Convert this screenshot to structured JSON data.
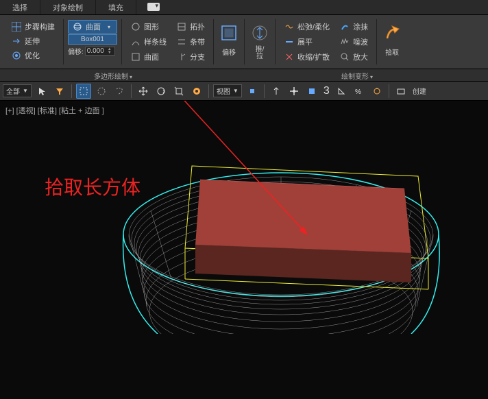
{
  "tabs": {
    "select": "选择",
    "object_paint": "对象绘制",
    "fill": "填充"
  },
  "ribbon": {
    "step_build": "步骤构建",
    "extend": "延伸",
    "optimize": "优化",
    "surface": "曲面",
    "object_name": "Box001",
    "offset_label": "偏移:",
    "offset_value": "0.000",
    "shape": "图形",
    "spline": "样条线",
    "face": "曲面",
    "topology": "拓扑",
    "strip": "条带",
    "branch": "分支",
    "offset_big": "偏移",
    "push_pull_1": "推/",
    "push_pull_2": "拉",
    "relax_soften": "松弛/柔化",
    "flatten": "展平",
    "shrink_expand": "收缩/扩散",
    "smear": "涂抹",
    "noise": "噪波",
    "zoom": "放大",
    "pick": "拾取"
  },
  "group_labels": {
    "poly_draw": "多边形绘制",
    "paint_deform": "绘制变形"
  },
  "toolbar2": {
    "all": "全部",
    "view": "视图",
    "create": "创建"
  },
  "viewport": {
    "label": "[+] [透视] [标准] [粘土 + 边面 ]"
  },
  "annotation": "拾取长方体"
}
